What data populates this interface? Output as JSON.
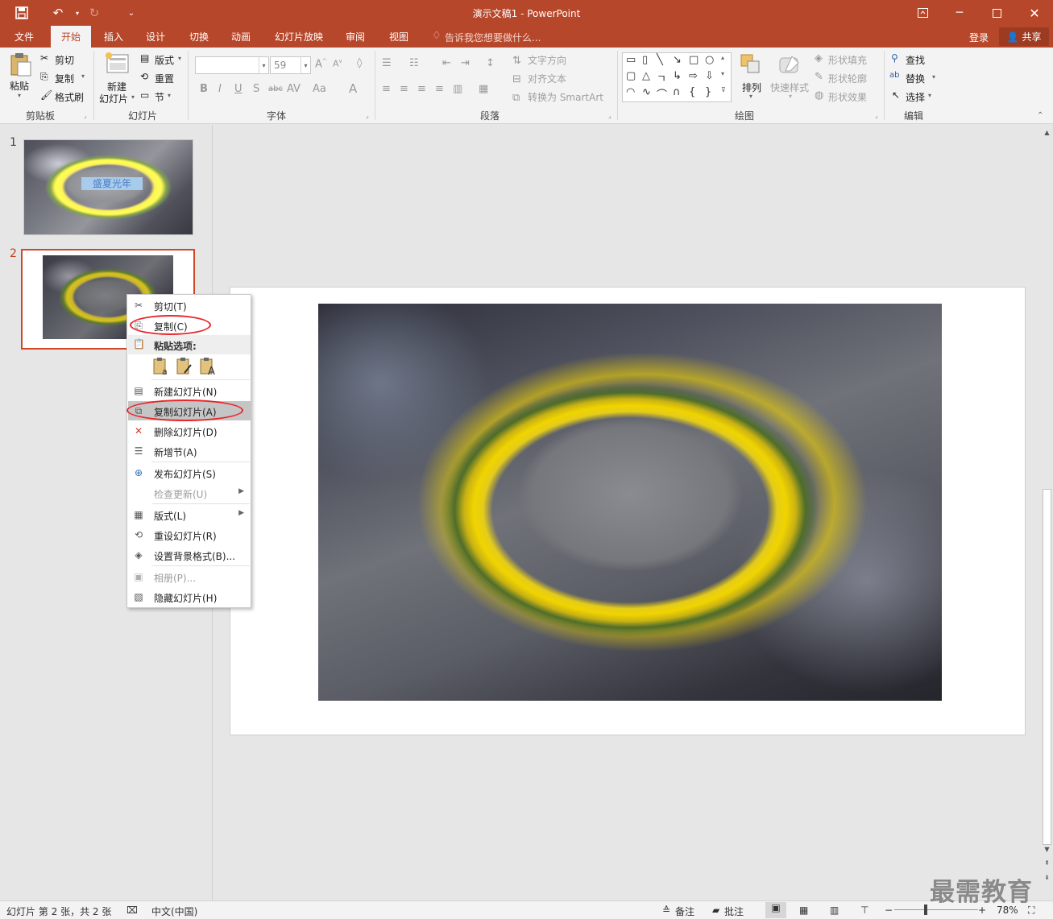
{
  "titlebar": {
    "title": "演示文稿1 - PowerPoint",
    "save_icon": "save-icon",
    "undo_icon": "undo-icon",
    "redo_icon": "redo-icon",
    "customize_icon": "customize-quick-access-icon"
  },
  "tabs": [
    "文件",
    "开始",
    "插入",
    "设计",
    "切换",
    "动画",
    "幻灯片放映",
    "审阅",
    "视图"
  ],
  "active_tab": "开始",
  "tell_me": "告诉我您想要做什么...",
  "login": "登录",
  "share": "共享",
  "ribbon": {
    "clipboard": {
      "paste": "粘贴",
      "cut": "剪切",
      "copy": "复制",
      "format_painter": "格式刷",
      "label": "剪贴板"
    },
    "slides": {
      "new_slide_1": "新建",
      "new_slide_2": "幻灯片",
      "layout": "版式",
      "reset": "重置",
      "section": "节",
      "label": "幻灯片"
    },
    "font": {
      "font_name": "",
      "font_size": "59",
      "label": "字体"
    },
    "paragraph": {
      "text_direction": "文字方向",
      "align_text": "对齐文本",
      "smartart": "转换为 SmartArt",
      "label": "段落"
    },
    "drawing": {
      "arrange": "排列",
      "quick_styles": "快速样式",
      "fill": "形状填充",
      "outline": "形状轮廓",
      "effects": "形状效果",
      "label": "绘图"
    },
    "editing": {
      "find": "查找",
      "replace": "替换",
      "select": "选择",
      "label": "编辑"
    }
  },
  "slides": [
    {
      "number": "1",
      "title_text": "盛夏光年",
      "selected": false
    },
    {
      "number": "2",
      "selected": true
    }
  ],
  "context_menu": {
    "cut": "剪切(T)",
    "copy": "复制(C)",
    "paste_options": "粘贴选项:",
    "new_slide": "新建幻灯片(N)",
    "duplicate_slide": "复制幻灯片(A)",
    "delete_slide": "删除幻灯片(D)",
    "add_section": "新增节(A)",
    "publish_slides": "发布幻灯片(S)",
    "check_updates": "检查更新(U)",
    "layout": "版式(L)",
    "reset_slide": "重设幻灯片(R)",
    "format_background": "设置背景格式(B)...",
    "photo_album": "相册(P)...",
    "hide_slide": "隐藏幻灯片(H)"
  },
  "statusbar": {
    "slide_info": "幻灯片 第 2 张，共 2 张",
    "language": "中文(中国)",
    "notes": "备注",
    "comments": "批注",
    "zoom": "78%"
  },
  "watermark": "最需教育",
  "colors": {
    "accent": "#b7472a",
    "highlight_ring": "#e8262c"
  }
}
